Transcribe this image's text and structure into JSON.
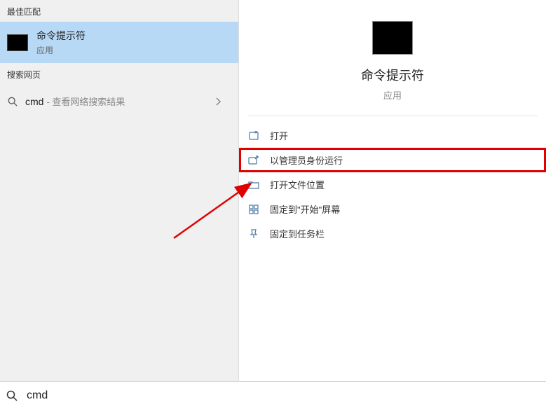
{
  "left": {
    "best_match_header": "最佳匹配",
    "best_match": {
      "title": "命令提示符",
      "subtitle": "应用"
    },
    "web_header": "搜索网页",
    "web_query": "cmd",
    "web_suffix": "- 查看网络搜索结果"
  },
  "preview": {
    "title": "命令提示符",
    "subtitle": "应用"
  },
  "actions": [
    {
      "icon": "open-icon",
      "label": "打开"
    },
    {
      "icon": "admin-icon",
      "label": "以管理员身份运行"
    },
    {
      "icon": "folder-icon",
      "label": "打开文件位置"
    },
    {
      "icon": "pin-start-icon",
      "label": "固定到\"开始\"屏幕"
    },
    {
      "icon": "pin-taskbar-icon",
      "label": "固定到任务栏"
    }
  ],
  "search": {
    "value": "cmd"
  }
}
